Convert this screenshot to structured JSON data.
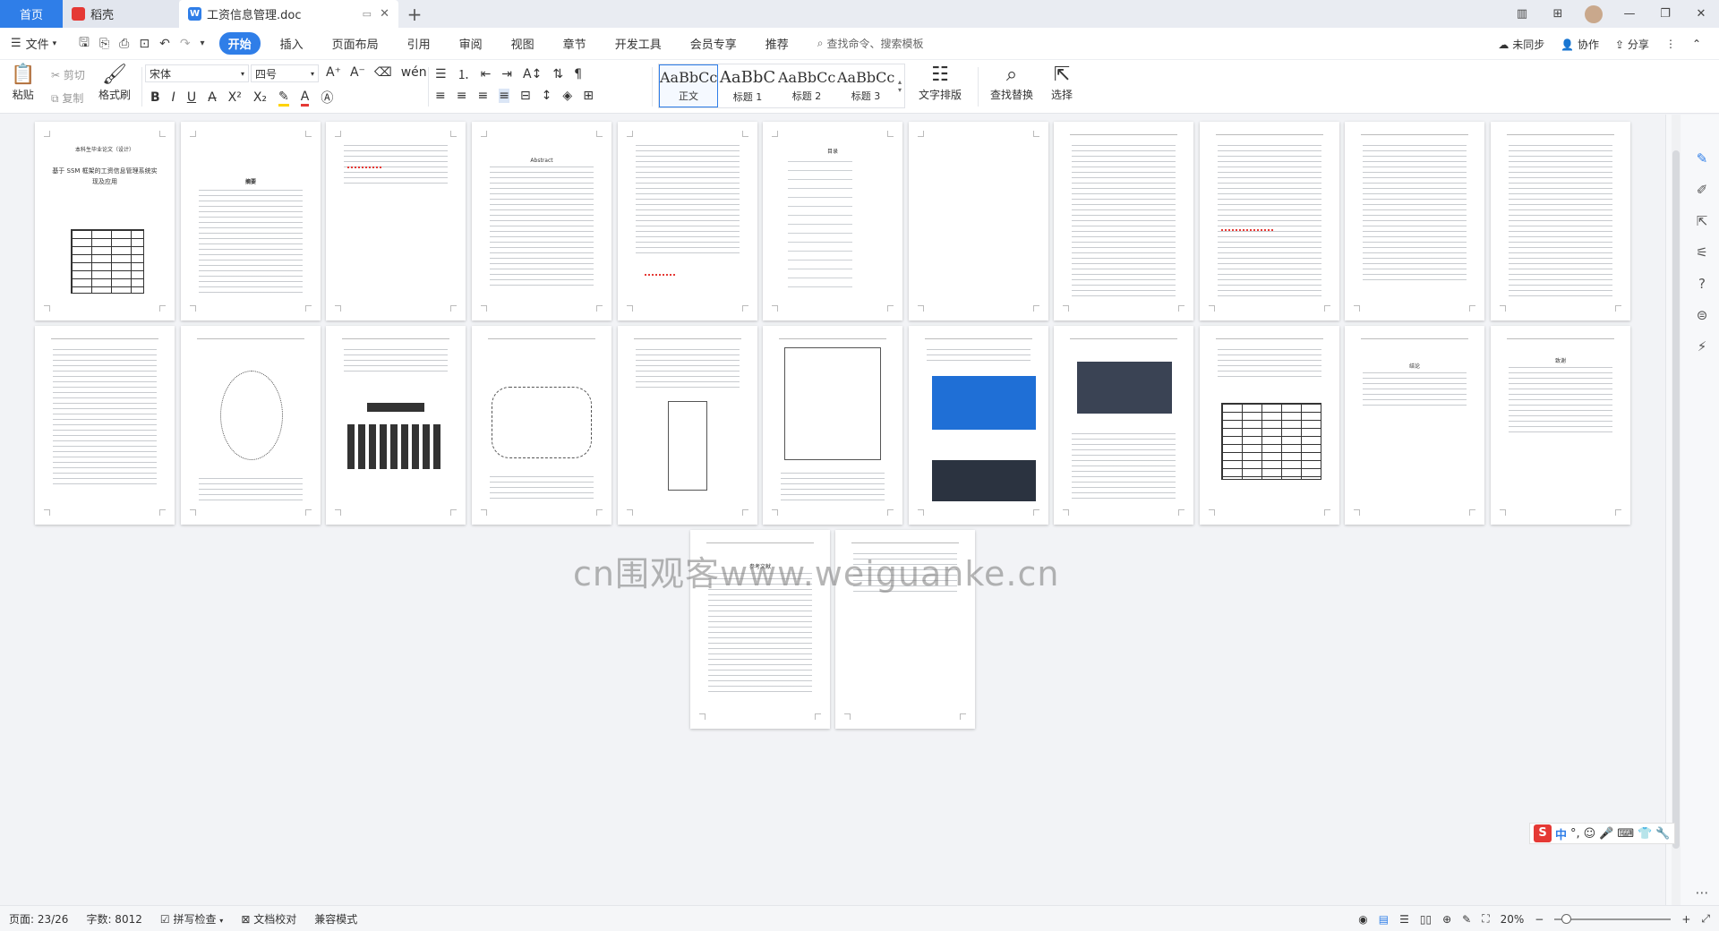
{
  "tabs": {
    "home": "首页",
    "daoke": "稻壳",
    "doc": "工资信息管理.doc"
  },
  "menu": {
    "file": "文件",
    "tabs": [
      "开始",
      "插入",
      "页面布局",
      "引用",
      "审阅",
      "视图",
      "章节",
      "开发工具",
      "会员专享",
      "推荐"
    ],
    "search": "查找命令、搜索模板",
    "sync": "未同步",
    "collab": "协作",
    "share": "分享"
  },
  "ribbon": {
    "paste": "粘贴",
    "cut": "剪切",
    "copy": "复制",
    "format_painter": "格式刷",
    "font_name": "宋体",
    "font_size": "四号",
    "styles": [
      {
        "sample": "AaBbCcI",
        "label": "正文"
      },
      {
        "sample": "AaBbC",
        "label": "标题 1"
      },
      {
        "sample": "AaBbCc",
        "label": "标题 2"
      },
      {
        "sample": "AaBbCc",
        "label": "标题 3"
      }
    ],
    "text_layout": "文字排版",
    "find_replace": "查找替换",
    "select": "选择"
  },
  "document": {
    "cover_title_1": "本科生毕业论文（设计）",
    "cover_title_2": "基于 SSM 框架的工资信息管理系统实",
    "cover_title_3": "现及应用",
    "abstract_title": "摘要",
    "abstract_en_title": "Abstract",
    "toc_title": "目录",
    "conclusion_title": "结论",
    "thanks_title": "致谢",
    "refs_title": "参考文献"
  },
  "watermark": "cn围观客www.weiguanke.cn",
  "ime": {
    "zh": "中"
  },
  "status": {
    "page": "页面: 23/26",
    "words": "字数: 8012",
    "spell": "拼写检查",
    "proof": "文档校对",
    "compat": "兼容模式",
    "zoom": "20%"
  }
}
